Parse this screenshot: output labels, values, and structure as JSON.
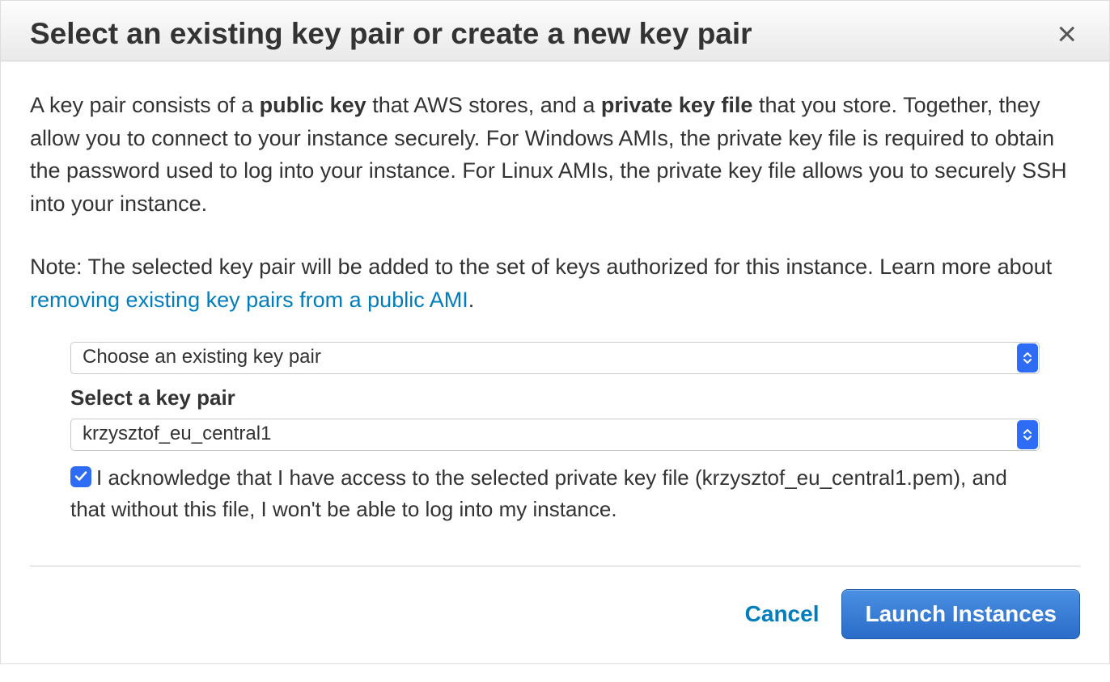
{
  "modal": {
    "title": "Select an existing key pair or create a new key pair",
    "close_symbol": "×"
  },
  "body": {
    "desc_part1": "A key pair consists of a ",
    "desc_bold1": "public key",
    "desc_part2": " that AWS stores, and a ",
    "desc_bold2": "private key file",
    "desc_part3": " that you store. Together, they allow you to connect to your instance securely. For Windows AMIs, the private key file is required to obtain the password used to log into your instance. For Linux AMIs, the private key file allows you to securely SSH into your instance.",
    "note_part1": "Note: The selected key pair will be added to the set of keys authorized for this instance. Learn more about ",
    "note_link_text": "removing existing key pairs from a public AMI",
    "note_part2": "."
  },
  "form": {
    "action_select_value": "Choose an existing key pair",
    "keypair_label": "Select a key pair",
    "keypair_select_value": "krzysztof_eu_central1",
    "ack_text": "I acknowledge that I have access to the selected private key file (krzysztof_eu_central1.pem), and that without this file, I won't be able to log into my instance.",
    "ack_checked": true
  },
  "footer": {
    "cancel_label": "Cancel",
    "launch_label": "Launch Instances"
  }
}
